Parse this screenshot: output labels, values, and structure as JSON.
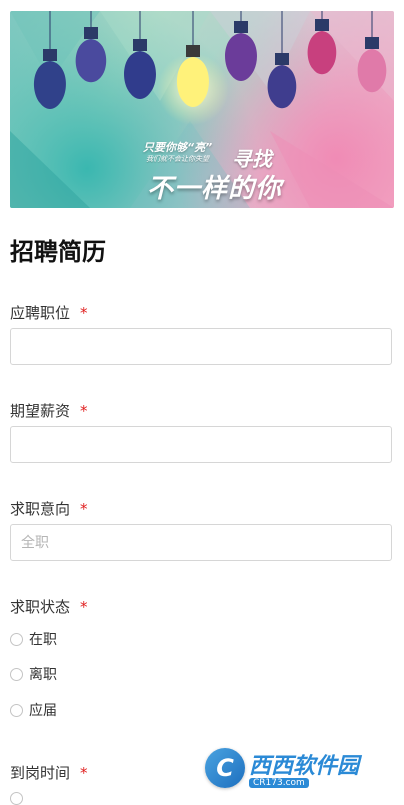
{
  "banner": {
    "slogan_line1": "只要你够“亮”",
    "slogan_line2": "我们就不会让你失望",
    "slogan_find": "寻找",
    "slogan_big": "不一样的你"
  },
  "form": {
    "title": "招聘简历",
    "required_mark": "*",
    "fields": [
      {
        "label": "应聘职位",
        "value": "",
        "placeholder": ""
      },
      {
        "label": "期望薪资",
        "value": "",
        "placeholder": ""
      },
      {
        "label": "求职意向",
        "value": "",
        "placeholder": "全职"
      }
    ],
    "status": {
      "label": "求职状态",
      "options": [
        "在职",
        "离职",
        "应届"
      ]
    },
    "arrival": {
      "label": "到岗时间"
    }
  },
  "watermark": {
    "logo_letter": "C",
    "name": "西西软件园",
    "url": "CR173.com"
  }
}
